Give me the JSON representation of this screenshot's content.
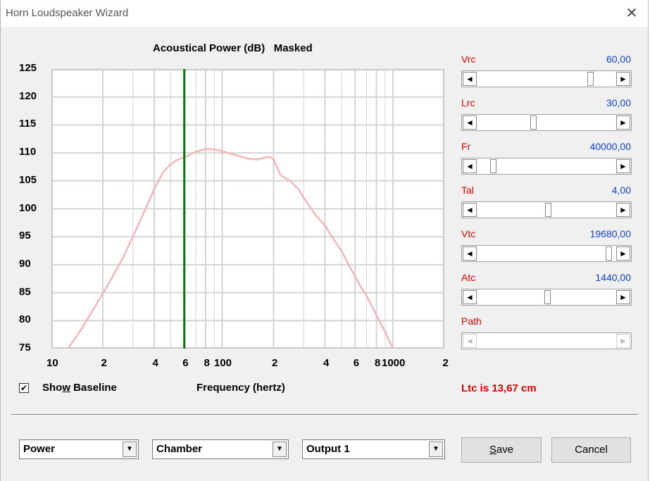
{
  "window": {
    "title": "Horn Loudspeaker Wizard"
  },
  "chart_data": {
    "type": "line",
    "title": "Acoustical Power (dB)   Masked",
    "xlabel": "Frequency (hertz)",
    "ylabel": "",
    "xscale": "log",
    "xlim": [
      10,
      2000
    ],
    "ylim": [
      75,
      125
    ],
    "y_ticks": [
      "125",
      "120",
      "115",
      "110",
      "105",
      "100",
      "95",
      "90",
      "85",
      "80",
      "75"
    ],
    "x_tick_labels": [
      {
        "v": 10,
        "t": "10"
      },
      {
        "v": 20,
        "t": "2"
      },
      {
        "v": 40,
        "t": "4"
      },
      {
        "v": 60,
        "t": "6"
      },
      {
        "v": 80,
        "t": "8"
      },
      {
        "v": 100,
        "t": "100"
      },
      {
        "v": 200,
        "t": "2"
      },
      {
        "v": 400,
        "t": "4"
      },
      {
        "v": 600,
        "t": "6"
      },
      {
        "v": 800,
        "t": "8"
      },
      {
        "v": 1000,
        "t": "1000"
      },
      {
        "v": 2000,
        "t": "2"
      }
    ],
    "grid": true,
    "marker_frequency": 60,
    "marker_color": "#007a00",
    "curve_color": "#f4b6b6",
    "series": [
      {
        "x": [
          12.5,
          15,
          18,
          22,
          26,
          30,
          35,
          40,
          45,
          50,
          55,
          60,
          70,
          80,
          90,
          100,
          120,
          140,
          160,
          180,
          190,
          200,
          220,
          250,
          280,
          300,
          350,
          400,
          450,
          500,
          550,
          600,
          650,
          700,
          800,
          900,
          1000
        ],
        "y": [
          75,
          78.5,
          82.5,
          87,
          91,
          95,
          99.5,
          103.5,
          106.5,
          108,
          108.8,
          109.2,
          110.2,
          110.7,
          110.6,
          110.3,
          109.6,
          109,
          108.8,
          109.2,
          109.3,
          108.8,
          106,
          105,
          103.5,
          102,
          99,
          97,
          94.5,
          92.5,
          90,
          88,
          86,
          84.5,
          81,
          78,
          75
        ]
      }
    ]
  },
  "show_baseline": {
    "label": "Show Baseline",
    "checked": true,
    "check_glyph": "✔"
  },
  "params": [
    {
      "name": "Vrc",
      "value": "60,00",
      "pos": 0.82
    },
    {
      "name": "Lrc",
      "value": "30,00",
      "pos": 0.4
    },
    {
      "name": "Fr",
      "value": "40000,00",
      "pos": 0.1
    },
    {
      "name": "Tal",
      "value": "4,00",
      "pos": 0.51
    },
    {
      "name": "Vtc",
      "value": "19680,00",
      "pos": 0.96
    },
    {
      "name": "Atc",
      "value": "1440,00",
      "pos": 0.5
    },
    {
      "name": "Path",
      "value": ""
    }
  ],
  "status": "Ltc is 13,67 cm",
  "dropdowns": {
    "mode": "Power",
    "location": "Chamber",
    "output": "Output 1"
  },
  "buttons": {
    "save": "Save",
    "cancel": "Cancel"
  },
  "icons": {
    "close": "close-icon",
    "arrow_left": "◄",
    "arrow_right": "►",
    "arrow_down": "▼"
  }
}
